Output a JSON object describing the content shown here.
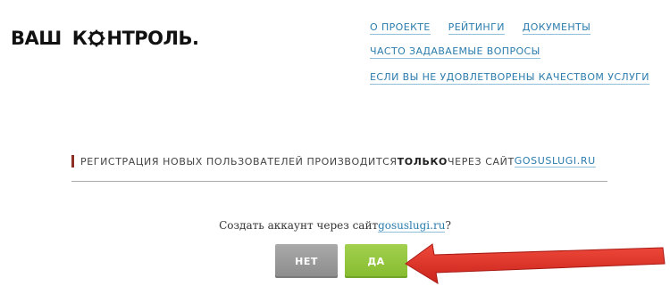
{
  "header": {
    "logo_word1": "ВАШ",
    "logo_word2_first": "К",
    "logo_word2_rest": "НТРОЛЬ."
  },
  "nav": {
    "about": "О ПРОЕКТЕ",
    "ratings": "РЕЙТИНГИ",
    "documents": "ДОКУМЕНТЫ",
    "faq": "ЧАСТО ЗАДАВАЕМЫЕ ВОПРОСЫ",
    "complaint": "ЕСЛИ ВЫ НЕ УДОВЛЕТВОРЕНЫ КАЧЕСТВОМ УСЛУГИ"
  },
  "notice": {
    "text_before": "РЕГИСТРАЦИЯ НОВЫХ ПОЛЬЗОВАТЕЛЕЙ ПРОИЗВОДИТСЯ",
    "text_strong": "ТОЛЬКО",
    "text_after": " ЧЕРЕЗ САЙТ",
    "link": "GOSUSLUGI.RU"
  },
  "dialog": {
    "question_before": "Создать аккаунт через сайт",
    "question_link": "gosuslugi.ru",
    "question_after": "?",
    "no_label": "НЕТ",
    "yes_label": "ДА"
  },
  "colors": {
    "link": "#2b7cad",
    "accent_bar": "#8b2e24",
    "button_no": "#999999",
    "button_yes": "#92c53a",
    "arrow": "#e0342a"
  }
}
